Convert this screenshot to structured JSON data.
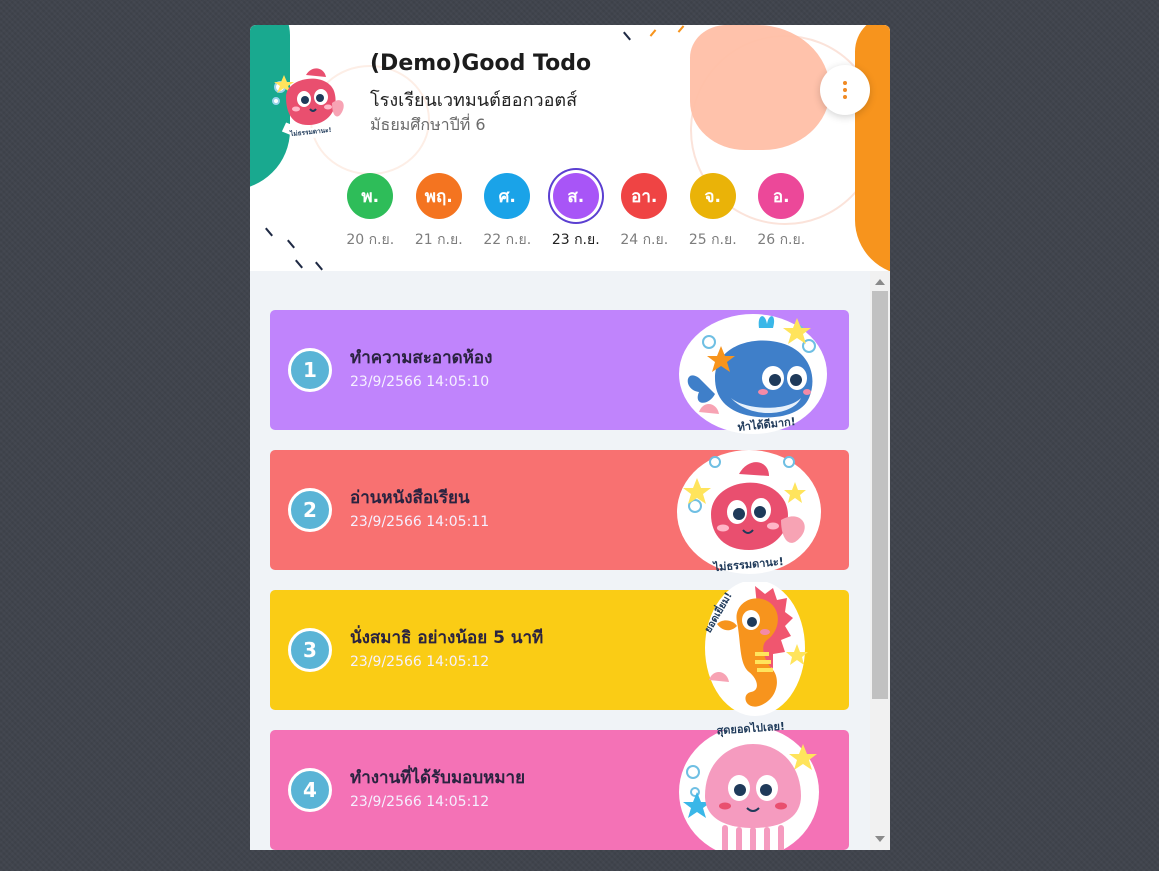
{
  "header": {
    "app_title": "(Demo)Good Todo",
    "school": "โรงเรียนเวทมนต์ฮอกวอตส์",
    "grade": "มัธยมศึกษาปีที่ 6",
    "logo_caption": "ไม่ธรรมดานะ!"
  },
  "days": [
    {
      "label": "พ.",
      "date": "20 ก.ย.",
      "color": "#2ebd59",
      "active": false
    },
    {
      "label": "พฤ.",
      "date": "21 ก.ย.",
      "color": "#f47420",
      "active": false
    },
    {
      "label": "ศ.",
      "date": "22 ก.ย.",
      "color": "#1aa3e8",
      "active": false
    },
    {
      "label": "ส.",
      "date": "23 ก.ย.",
      "color": "#a855f7",
      "active": true
    },
    {
      "label": "อา.",
      "date": "24 ก.ย.",
      "color": "#ef4444",
      "active": false
    },
    {
      "label": "จ.",
      "date": "25 ก.ย.",
      "color": "#eab308",
      "active": false
    },
    {
      "label": "อ.",
      "date": "26 ก.ย.",
      "color": "#ec4899",
      "active": false
    }
  ],
  "tasks": [
    {
      "number": "1",
      "title": "ทำความสะอาดห้อง",
      "time": "23/9/2566 14:05:10",
      "color": "#c084fc",
      "sticker": "whale",
      "sticker_caption": "ทำได้ดีมาก!"
    },
    {
      "number": "2",
      "title": "อ่านหนังสือเรียน",
      "time": "23/9/2566 14:05:11",
      "color": "#f87171",
      "sticker": "fish",
      "sticker_caption": "ไม่ธรรมดานะ!"
    },
    {
      "number": "3",
      "title": "นั่งสมาธิ อย่างน้อย 5 นาที",
      "time": "23/9/2566 14:05:12",
      "color": "#facc15",
      "sticker": "seahorse",
      "sticker_caption": "ยอดเยี่ยม!"
    },
    {
      "number": "4",
      "title": "ทำงานที่ได้รับมอบหมาย",
      "time": "23/9/2566 14:05:12",
      "color": "#f472b6",
      "sticker": "jellyfish",
      "sticker_caption": "สุดยอดไปเลย!"
    }
  ]
}
